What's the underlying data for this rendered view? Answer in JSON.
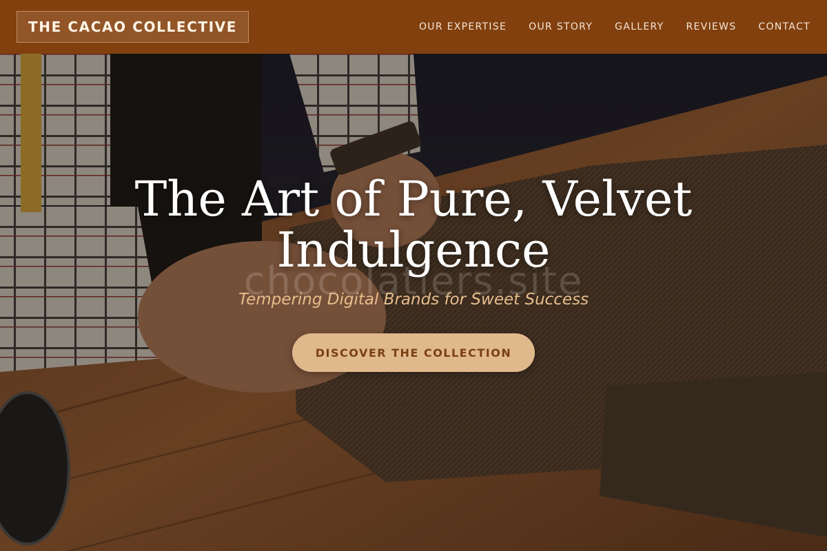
{
  "header": {
    "logo_text": "THE CACAO COLLECTIVE",
    "background_color": "#82400f",
    "nav": [
      {
        "label": "OUR EXPERTISE"
      },
      {
        "label": "OUR STORY"
      },
      {
        "label": "GALLERY"
      },
      {
        "label": "REVIEWS"
      },
      {
        "label": "CONTACT"
      }
    ]
  },
  "hero": {
    "title": "The Art of Pure, Velvet Indulgence",
    "watermark_text": "chocolatiers.site",
    "subtitle": "Tempering Digital Brands for Sweet Success",
    "cta_label": "DISCOVER THE COLLECTION",
    "background_image": "tailor-cutting-tweed-fabric-on-wooden-table",
    "subtitle_color": "#e6bd8c",
    "cta_color": "#dfb98c",
    "cta_text_color": "#7a3f12"
  }
}
